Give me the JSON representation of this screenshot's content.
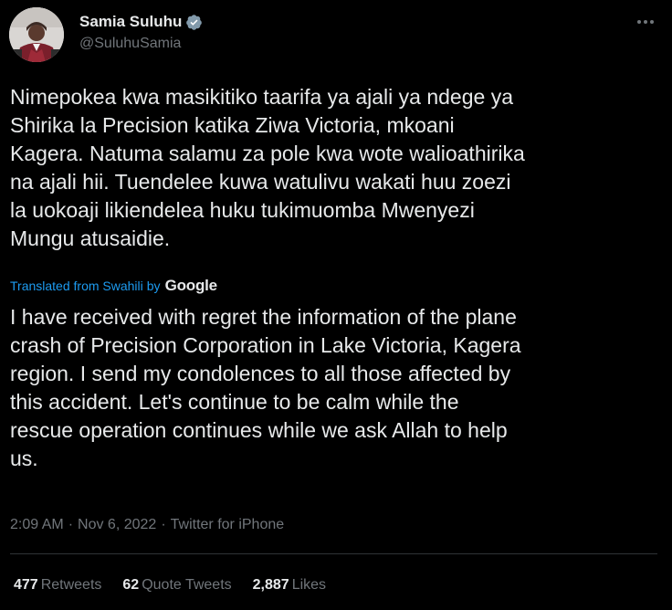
{
  "author": {
    "display_name": "Samia Suluhu",
    "handle": "@SuluhuSamia",
    "verified": true,
    "avatar_icon": "profile-photo"
  },
  "tweet": {
    "text": "Nimepokea kwa masikitiko taarifa ya ajali ya ndege ya\nShirika la Precision katika Ziwa Victoria, mkoani\nKagera. Natuma salamu za pole kwa wote walioathirika\nna ajali hii. Tuendelee kuwa watulivu wakati huu zoezi\nla uokoaji likiendelea huku tukimuomba Mwenyezi\nMungu atusaidie.",
    "translated_label": "Translated from Swahili",
    "translated_by": "by",
    "translator_brand": "Google",
    "translation": "I have received with regret the information of the plane\ncrash of Precision Corporation in Lake Victoria, Kagera\nregion. I send my condolences to all those affected by\nthis accident. Let's continue to be calm while the\nrescue operation continues while we ask Allah to help\nus."
  },
  "meta": {
    "time": "2:09 AM",
    "separator": "·",
    "date": "Nov 6, 2022",
    "source": "Twitter for iPhone"
  },
  "stats": {
    "retweets_count": "477",
    "retweets_label": "Retweets",
    "quotes_count": "62",
    "quotes_label": "Quote Tweets",
    "likes_count": "2,887",
    "likes_label": "Likes"
  },
  "colors": {
    "background": "#000000",
    "text": "#e7e9ea",
    "secondary": "#71767b",
    "link": "#1d9bf0",
    "verified": "#829aab",
    "divider": "#2f3336"
  }
}
